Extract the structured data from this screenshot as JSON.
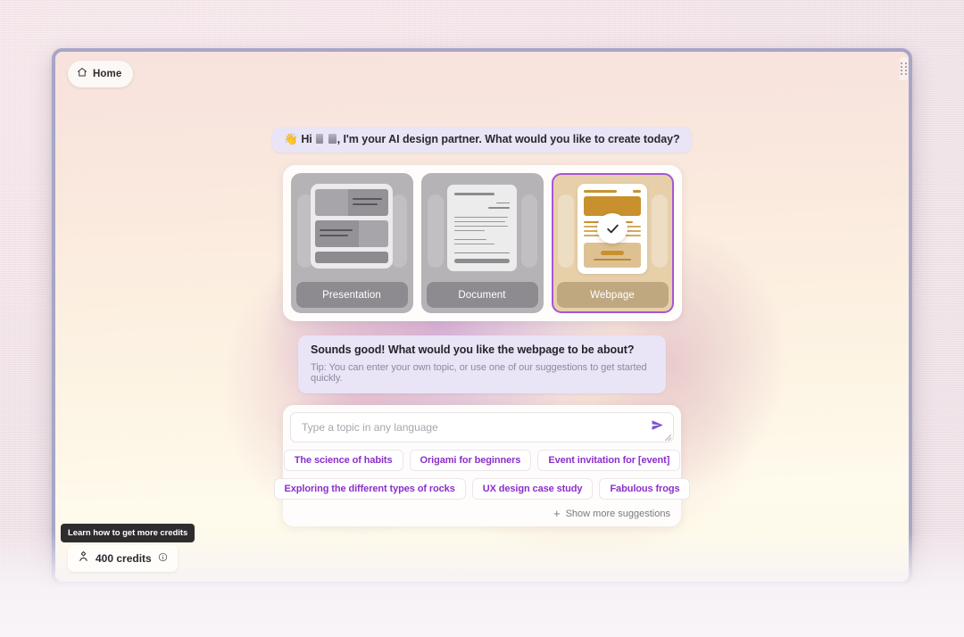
{
  "window": {
    "home_button": {
      "label": "Home",
      "icon": "home-icon"
    },
    "drag_handle_icon": "drag-handle-icon"
  },
  "conversation": {
    "greeting": {
      "emoji_wave": "👋",
      "prefix": "Hi",
      "text": ", I'm your AI design partner. What would you like to create today?"
    },
    "prompt": {
      "title": "Sounds good! What would you like the webpage to be about?",
      "tip": "Tip: You can enter your own topic, or use one of our suggestions to get started quickly."
    }
  },
  "type_chooser": {
    "cards": [
      {
        "label": "Presentation",
        "selected": false,
        "name": "presentation"
      },
      {
        "label": "Document",
        "selected": false,
        "name": "document"
      },
      {
        "label": "Webpage",
        "selected": true,
        "name": "webpage"
      }
    ],
    "selected_indicator_icon": "check-icon",
    "selected_border_color": "#a855d6"
  },
  "composer": {
    "input": {
      "value": "",
      "placeholder": "Type a topic in any language"
    },
    "send_icon": "send-icon",
    "resize_grip_icon": "resize-grip-icon",
    "suggestions_row_1": [
      "The science of habits",
      "Origami for beginners",
      "Event invitation for [event]"
    ],
    "suggestions_row_2": [
      "Exploring the different types of rocks",
      "UX design case study",
      "Fabulous frogs"
    ],
    "show_more": {
      "label": "Show more suggestions",
      "icon": "plus-icon"
    },
    "chip_text_color": "#8b2fc9"
  },
  "footer": {
    "credits": {
      "amount": "400 credits",
      "icon": "credits-gem-icon",
      "info_icon": "info-icon"
    },
    "tooltip": "Learn how to get more credits"
  }
}
